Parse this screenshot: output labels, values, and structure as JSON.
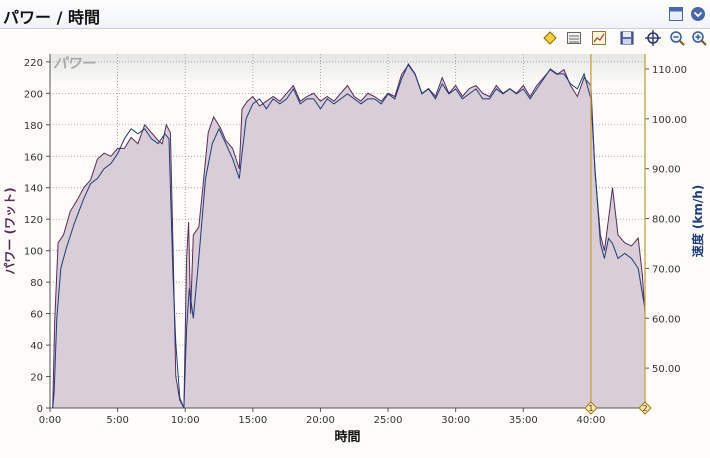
{
  "window": {
    "title": "パワー / 時間"
  },
  "icons": {
    "restore": "window-restore-icon",
    "menu": "dropdown-circle-icon",
    "toolbar": [
      "diamond-icon",
      "list-lines-icon",
      "chart-image-icon",
      "save-disk-icon",
      "crosshair-icon",
      "zoom-out-icon",
      "zoom-in-icon"
    ]
  },
  "chart_data": {
    "type": "area",
    "panel_label": "パワー",
    "xlabel": "時間",
    "ylabel_left": "パワー (ワット)",
    "ylabel_right": "速度 (km/h)",
    "x_unit": "minutes",
    "xlim": [
      0,
      44
    ],
    "ylim_left": [
      0,
      225
    ],
    "ylim_right": [
      42,
      113
    ],
    "x_ticks": [
      "0:00",
      "5:00",
      "10:00",
      "15:00",
      "20:00",
      "25:00",
      "30:00",
      "35:00",
      "40:00"
    ],
    "y_ticks_left": [
      "0",
      "20",
      "40",
      "60",
      "80",
      "100",
      "120",
      "140",
      "160",
      "180",
      "200",
      "220"
    ],
    "y_ticks_right": [
      "50.00",
      "60.00",
      "70.00",
      "80.00",
      "90.00",
      "100.00",
      "110.00"
    ],
    "grid": true,
    "colors": {
      "power_fill": "#d9cdd7",
      "power_line": "#5a2a58",
      "speed_line": "#1e3c7a",
      "marker_line": "#c8a040",
      "panel_top": "#e6e6e6"
    },
    "series": [
      {
        "name": "パワー",
        "axis": "left",
        "points": [
          [
            0.2,
            0
          ],
          [
            0.35,
            55
          ],
          [
            0.6,
            105
          ],
          [
            1.0,
            110
          ],
          [
            1.5,
            125
          ],
          [
            2.0,
            132
          ],
          [
            2.5,
            140
          ],
          [
            3.0,
            145
          ],
          [
            3.5,
            158
          ],
          [
            4.0,
            162
          ],
          [
            4.5,
            160
          ],
          [
            5.0,
            165
          ],
          [
            5.5,
            165
          ],
          [
            6.0,
            172
          ],
          [
            6.5,
            168
          ],
          [
            7.0,
            180
          ],
          [
            7.5,
            175
          ],
          [
            8.0,
            170
          ],
          [
            8.3,
            168
          ],
          [
            8.6,
            180
          ],
          [
            8.9,
            175
          ],
          [
            9.1,
            100
          ],
          [
            9.3,
            20
          ],
          [
            9.6,
            5
          ],
          [
            9.9,
            0
          ],
          [
            10.1,
            95
          ],
          [
            10.25,
            118
          ],
          [
            10.4,
            60
          ],
          [
            10.6,
            110
          ],
          [
            11.0,
            115
          ],
          [
            11.3,
            140
          ],
          [
            11.7,
            175
          ],
          [
            12.1,
            185
          ],
          [
            12.6,
            178
          ],
          [
            13.0,
            170
          ],
          [
            13.5,
            165
          ],
          [
            14.0,
            152
          ],
          [
            14.2,
            190
          ],
          [
            14.6,
            195
          ],
          [
            15.0,
            198
          ],
          [
            15.5,
            192
          ],
          [
            16.0,
            195
          ],
          [
            16.5,
            198
          ],
          [
            17.0,
            195
          ],
          [
            17.5,
            200
          ],
          [
            18.0,
            205
          ],
          [
            18.5,
            195
          ],
          [
            19.0,
            198
          ],
          [
            19.5,
            200
          ],
          [
            20.0,
            195
          ],
          [
            20.5,
            198
          ],
          [
            21.0,
            195
          ],
          [
            21.5,
            200
          ],
          [
            22.0,
            205
          ],
          [
            22.5,
            198
          ],
          [
            23.0,
            195
          ],
          [
            23.5,
            200
          ],
          [
            24.0,
            198
          ],
          [
            24.5,
            195
          ],
          [
            25.0,
            200
          ],
          [
            25.5,
            198
          ],
          [
            26.0,
            212
          ],
          [
            26.5,
            218
          ],
          [
            27.0,
            212
          ],
          [
            27.5,
            200
          ],
          [
            28.0,
            203
          ],
          [
            28.5,
            198
          ],
          [
            29.0,
            210
          ],
          [
            29.5,
            200
          ],
          [
            30.0,
            205
          ],
          [
            30.5,
            198
          ],
          [
            31.0,
            203
          ],
          [
            31.5,
            205
          ],
          [
            32.0,
            200
          ],
          [
            32.5,
            198
          ],
          [
            33.0,
            205
          ],
          [
            33.5,
            200
          ],
          [
            34.0,
            203
          ],
          [
            34.5,
            200
          ],
          [
            35.0,
            205
          ],
          [
            35.5,
            198
          ],
          [
            36.0,
            205
          ],
          [
            36.5,
            210
          ],
          [
            37.0,
            215
          ],
          [
            37.5,
            212
          ],
          [
            38.0,
            215
          ],
          [
            38.5,
            205
          ],
          [
            39.0,
            198
          ],
          [
            39.5,
            210
          ],
          [
            40.0,
            205
          ],
          [
            40.3,
            150
          ],
          [
            40.7,
            110
          ],
          [
            41.0,
            100
          ],
          [
            41.3,
            120
          ],
          [
            41.6,
            140
          ],
          [
            42.0,
            110
          ],
          [
            42.5,
            105
          ],
          [
            43.0,
            103
          ],
          [
            43.5,
            108
          ],
          [
            43.8,
            85
          ],
          [
            44.0,
            60
          ]
        ]
      },
      {
        "name": "速度",
        "axis": "right",
        "points": [
          [
            0.2,
            42
          ],
          [
            0.3,
            45
          ],
          [
            0.5,
            60
          ],
          [
            0.8,
            70
          ],
          [
            1.2,
            74
          ],
          [
            1.8,
            79
          ],
          [
            2.5,
            84
          ],
          [
            3.0,
            87
          ],
          [
            3.5,
            88
          ],
          [
            4.0,
            90
          ],
          [
            4.5,
            91
          ],
          [
            5.0,
            93
          ],
          [
            5.5,
            96
          ],
          [
            6.0,
            98
          ],
          [
            6.5,
            97
          ],
          [
            7.0,
            98
          ],
          [
            7.5,
            96
          ],
          [
            8.0,
            95
          ],
          [
            8.5,
            97
          ],
          [
            8.8,
            96
          ],
          [
            9.1,
            68
          ],
          [
            9.3,
            55
          ],
          [
            9.6,
            44
          ],
          [
            9.9,
            42
          ],
          [
            10.1,
            58
          ],
          [
            10.3,
            66
          ],
          [
            10.6,
            60
          ],
          [
            11.0,
            72
          ],
          [
            11.5,
            88
          ],
          [
            12.0,
            95
          ],
          [
            12.5,
            98
          ],
          [
            13.0,
            95
          ],
          [
            13.5,
            92
          ],
          [
            14.0,
            88
          ],
          [
            14.2,
            93
          ],
          [
            14.5,
            100
          ],
          [
            15.0,
            103
          ],
          [
            15.5,
            104
          ],
          [
            16.0,
            102
          ],
          [
            16.5,
            104
          ],
          [
            17.0,
            103
          ],
          [
            17.5,
            104
          ],
          [
            18.0,
            106
          ],
          [
            18.5,
            103
          ],
          [
            19.0,
            104
          ],
          [
            19.5,
            104
          ],
          [
            20.0,
            102
          ],
          [
            20.5,
            104
          ],
          [
            21.0,
            103
          ],
          [
            21.5,
            104
          ],
          [
            22.0,
            105
          ],
          [
            22.5,
            104
          ],
          [
            23.0,
            103
          ],
          [
            23.5,
            104
          ],
          [
            24.0,
            104
          ],
          [
            24.5,
            103
          ],
          [
            25.0,
            105
          ],
          [
            25.5,
            104
          ],
          [
            26.0,
            108
          ],
          [
            26.5,
            111
          ],
          [
            27.0,
            109
          ],
          [
            27.5,
            105
          ],
          [
            28.0,
            106
          ],
          [
            28.5,
            104
          ],
          [
            29.0,
            107
          ],
          [
            29.5,
            105
          ],
          [
            30.0,
            106
          ],
          [
            30.5,
            104
          ],
          [
            31.0,
            105
          ],
          [
            31.5,
            106
          ],
          [
            32.0,
            104
          ],
          [
            32.5,
            104
          ],
          [
            33.0,
            106
          ],
          [
            33.5,
            105
          ],
          [
            34.0,
            106
          ],
          [
            34.5,
            105
          ],
          [
            35.0,
            106
          ],
          [
            35.5,
            104
          ],
          [
            36.0,
            106
          ],
          [
            36.5,
            108
          ],
          [
            37.0,
            110
          ],
          [
            37.5,
            109
          ],
          [
            38.0,
            109
          ],
          [
            38.5,
            107
          ],
          [
            39.0,
            106
          ],
          [
            39.5,
            109
          ],
          [
            40.0,
            104
          ],
          [
            40.3,
            90
          ],
          [
            40.7,
            75
          ],
          [
            41.0,
            72
          ],
          [
            41.3,
            76
          ],
          [
            41.6,
            75
          ],
          [
            42.0,
            72
          ],
          [
            42.5,
            73
          ],
          [
            43.0,
            72
          ],
          [
            43.5,
            70
          ],
          [
            43.8,
            65
          ],
          [
            44.0,
            62
          ]
        ]
      }
    ],
    "markers": [
      {
        "label": "1",
        "x": 40.0
      },
      {
        "label": "2",
        "x": 44.0
      }
    ]
  }
}
